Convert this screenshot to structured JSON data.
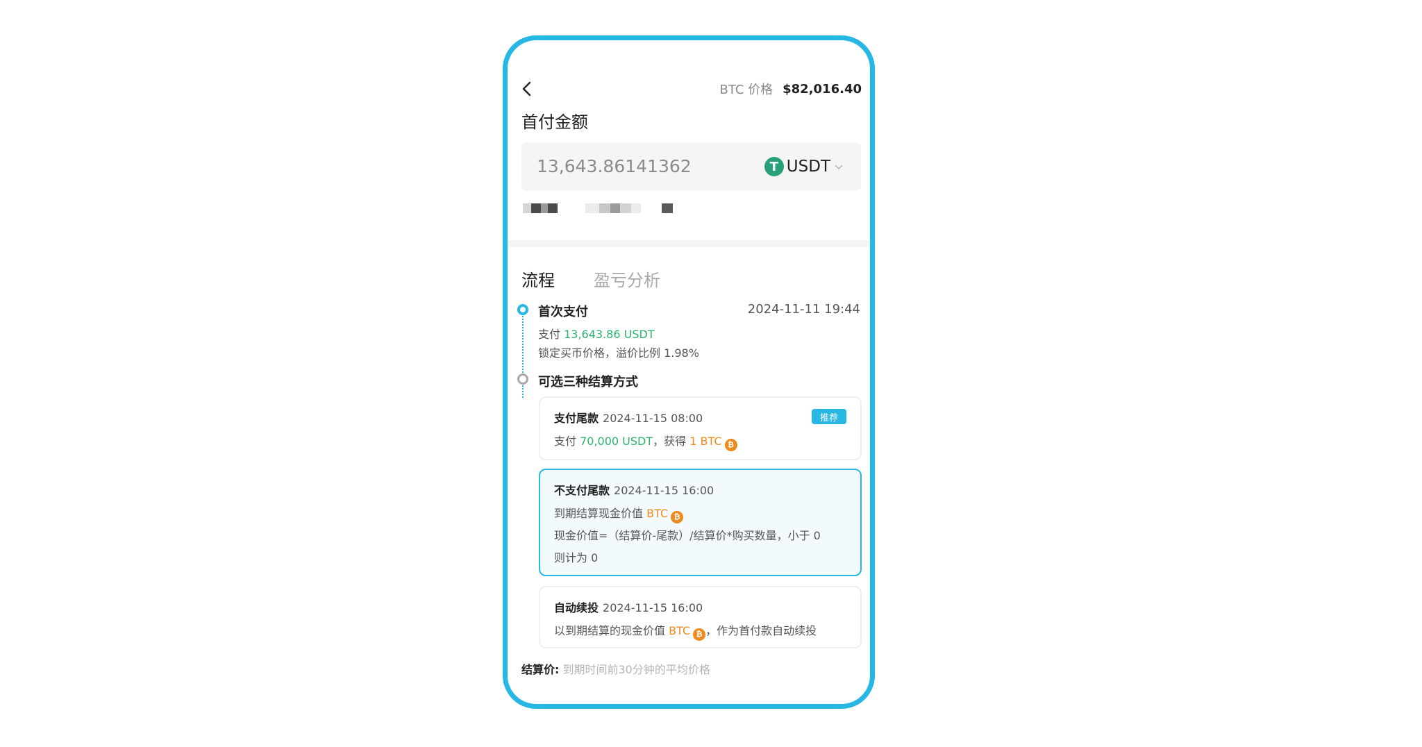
{
  "header": {
    "price_label": "BTC 价格",
    "price_value": "$82,016.40"
  },
  "down_payment": {
    "title": "首付金额",
    "amount": "13,643.86141362",
    "currency": "USDT",
    "currency_icon": "T"
  },
  "tabs": [
    {
      "label": "流程",
      "active": true
    },
    {
      "label": "盈亏分析",
      "active": false
    }
  ],
  "timeline": {
    "step1": {
      "title": "首次支付",
      "time": "2024-11-11 19:44",
      "pay_prefix": "支付",
      "pay_amount": "13,643.86 USDT",
      "note": "锁定买币价格，溢价比例 1.98%"
    },
    "step2": {
      "title": "可选三种结算方式"
    }
  },
  "options": [
    {
      "title": "支付尾款",
      "time": "2024-11-15 08:00",
      "badge": "推荐",
      "line1_prefix": "支付",
      "line1_amount": "70,000 USDT",
      "line1_mid": "，获得",
      "line1_btc": "1 BTC"
    },
    {
      "title": "不支付尾款",
      "time": "2024-11-15 16:00",
      "line1_prefix": "到期结算现金价值",
      "line1_btc": "BTC",
      "line2": "现金价值=（结算价-尾款）/结算价*购买数量，小于 0",
      "line3": "则计为 0"
    },
    {
      "title": "自动续投",
      "time": "2024-11-15 16:00",
      "line1_prefix": "以到期结算的现金价值",
      "line1_btc": "BTC",
      "line1_suffix": "，作为首付款自动续投"
    }
  ],
  "footer": {
    "label": "结算价:",
    "text": "到期时间前30分钟的平均价格"
  },
  "colors": {
    "accent": "#26b7e5",
    "green": "#2db36b",
    "orange": "#ef8a1e",
    "usdt": "#26a17b"
  }
}
